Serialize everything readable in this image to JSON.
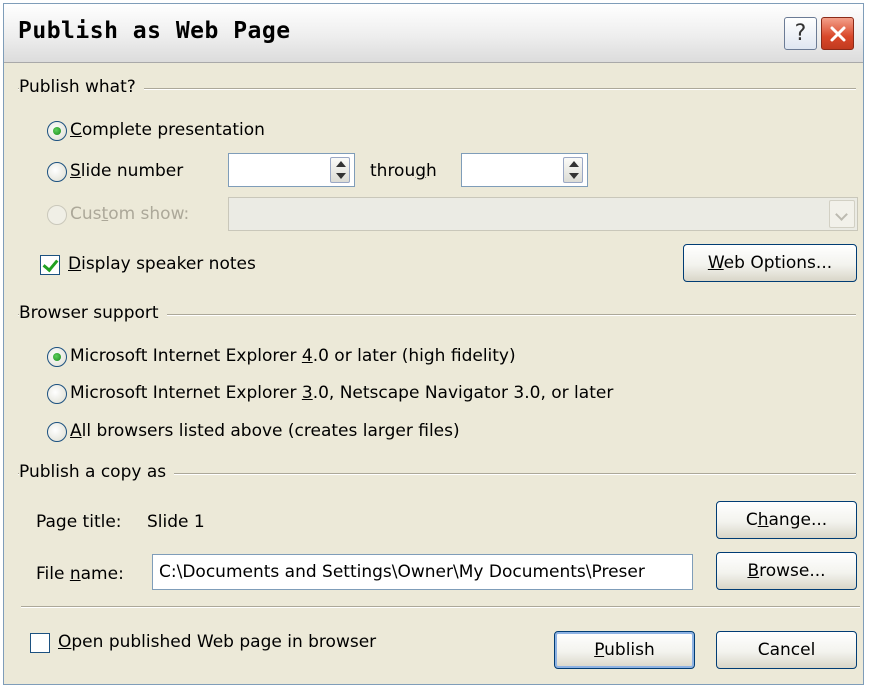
{
  "title": "Publish as Web Page",
  "titlebar_buttons": {
    "help": "?",
    "close": "×"
  },
  "publish_what": {
    "section_label": "Publish what?",
    "complete_presentation": {
      "pre": "",
      "key": "C",
      "post": "omplete presentation",
      "checked": true
    },
    "slide_number": {
      "pre": "",
      "key": "S",
      "post": "lide number",
      "checked": false,
      "from_value": "",
      "to_value": ""
    },
    "through": {
      "pre": "throu",
      "key": "g",
      "post": "h"
    },
    "custom_show": {
      "pre": "Cus",
      "key": "t",
      "post": "om show:",
      "disabled": true,
      "value": ""
    },
    "speaker_notes": {
      "pre": "",
      "key": "D",
      "post": "isplay speaker notes",
      "checked": true
    },
    "web_options_button": {
      "pre": "",
      "key": "W",
      "post": "eb Options..."
    }
  },
  "browser_support": {
    "section_label": "Browser support",
    "options": [
      {
        "pre": "Microsoft Internet Explorer ",
        "key": "4",
        "post": ".0 or later (high fidelity)",
        "checked": true
      },
      {
        "pre": "Microsoft Internet Explorer ",
        "key": "3",
        "post": ".0, Netscape Navigator 3.0, or later",
        "checked": false
      },
      {
        "pre": "",
        "key": "A",
        "post": "ll browsers listed above (creates larger files)",
        "checked": false
      }
    ]
  },
  "publish_copy": {
    "section_label": "Publish a copy as",
    "page_title_label": "Page title:",
    "page_title_value": "Slide 1",
    "change_button": {
      "pre": "C",
      "key": "h",
      "post": "ange..."
    },
    "file_name_label": {
      "pre": "File ",
      "key": "n",
      "post": "ame:"
    },
    "file_name_value": "C:\\Documents and Settings\\Owner\\My Documents\\Preser",
    "browse_button": {
      "pre": "",
      "key": "B",
      "post": "rowse..."
    }
  },
  "footer": {
    "open_in_browser": {
      "pre": "",
      "key": "O",
      "post": "pen published Web page in browser",
      "checked": false
    },
    "publish_button": {
      "pre": "",
      "key": "P",
      "post": "ublish"
    },
    "cancel_button": "Cancel"
  },
  "colors": {
    "dialog_bg": "#ece9d8",
    "border": "#7f9db9",
    "accent_green": "#21a121",
    "close_red": "#d9482a"
  },
  "icons": [
    "help-icon",
    "close-icon",
    "spin-up-down-icon",
    "dropdown-arrow-icon",
    "checkmark-icon"
  ]
}
